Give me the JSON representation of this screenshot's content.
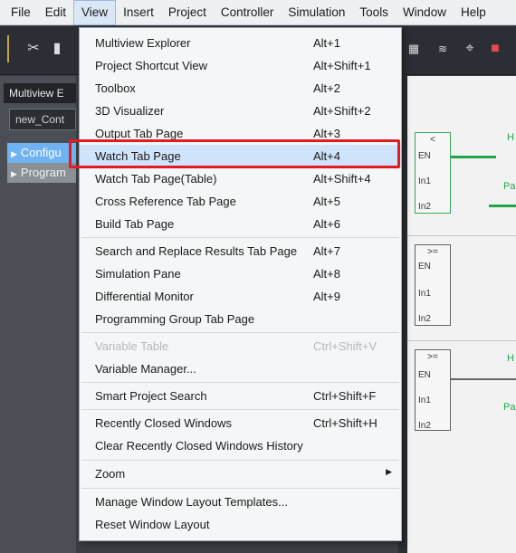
{
  "menubar": {
    "items": [
      "File",
      "Edit",
      "View",
      "Insert",
      "Project",
      "Controller",
      "Simulation",
      "Tools",
      "Window",
      "Help"
    ]
  },
  "left_pane": {
    "title": "Multiview E",
    "combo_value": "new_Cont",
    "tree": [
      "Configu",
      "Program"
    ]
  },
  "view_menu": {
    "items": [
      {
        "label": "Multiview Explorer",
        "shortcut": "Alt+1"
      },
      {
        "label": "Project Shortcut View",
        "shortcut": "Alt+Shift+1"
      },
      {
        "label": "Toolbox",
        "shortcut": "Alt+2"
      },
      {
        "label": "3D Visualizer",
        "shortcut": "Alt+Shift+2"
      },
      {
        "label": "Output Tab Page",
        "shortcut": "Alt+3"
      },
      {
        "label": "Watch Tab Page",
        "shortcut": "Alt+4"
      },
      {
        "label": "Watch Tab Page(Table)",
        "shortcut": "Alt+Shift+4"
      },
      {
        "label": "Cross Reference Tab Page",
        "shortcut": "Alt+5"
      },
      {
        "label": "Build Tab Page",
        "shortcut": "Alt+6"
      },
      {
        "label": "Search and Replace Results Tab Page",
        "shortcut": "Alt+7"
      },
      {
        "label": "Simulation Pane",
        "shortcut": "Alt+8"
      },
      {
        "label": "Differential Monitor",
        "shortcut": "Alt+9"
      },
      {
        "label": "Programming Group Tab Page",
        "shortcut": ""
      },
      {
        "label": "Variable Table",
        "shortcut": "Ctrl+Shift+V"
      },
      {
        "label": "Variable Manager...",
        "shortcut": ""
      },
      {
        "label": "Smart Project Search",
        "shortcut": "Ctrl+Shift+F"
      },
      {
        "label": "Recently Closed Windows",
        "shortcut": "Ctrl+Shift+H"
      },
      {
        "label": "Clear Recently Closed Windows History",
        "shortcut": ""
      },
      {
        "label": "Zoom",
        "shortcut": ""
      },
      {
        "label": "Manage Window Layout Templates...",
        "shortcut": ""
      },
      {
        "label": "Reset Window Layout",
        "shortcut": ""
      }
    ]
  },
  "ladder": {
    "blocks": [
      {
        "op": "<",
        "pins": [
          "EN",
          "In1",
          "In2"
        ]
      },
      {
        "op": ">=",
        "pins": [
          "EN",
          "In1",
          "In2"
        ]
      },
      {
        "op": ">=",
        "pins": [
          "EN",
          "In1",
          "In2"
        ]
      }
    ],
    "coil_labels": [
      "H",
      "Pa",
      "H",
      "Pa"
    ]
  },
  "colors": {
    "highlight_box": "#e11b22",
    "selected_tree": "#6fb3f2",
    "ladder_active": "#1fa64a"
  }
}
